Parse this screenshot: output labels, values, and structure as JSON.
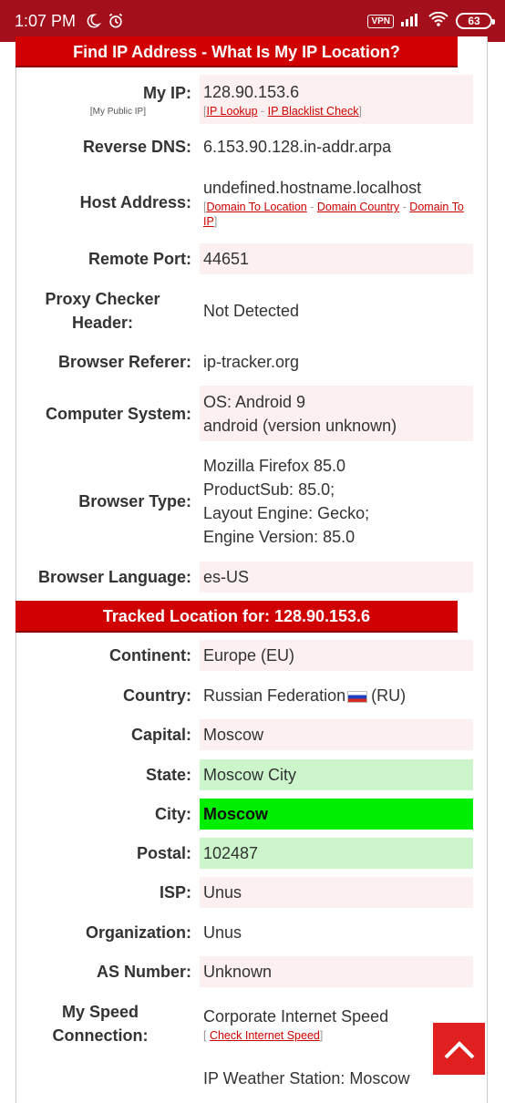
{
  "status_bar": {
    "time": "1:07 PM",
    "vpn": "VPN",
    "battery": "63"
  },
  "header1": {
    "title": "Find IP Address - What Is My IP Location?"
  },
  "rows1": [
    {
      "label": "My IP:",
      "sublabel": "[My Public IP]",
      "value": "128.90.153.6",
      "links": [
        "IP Lookup",
        "IP Blacklist Check"
      ],
      "bg": "pink"
    },
    {
      "label": "Reverse DNS:",
      "value": "6.153.90.128.in-addr.arpa"
    },
    {
      "label": "Host Address:",
      "value": "undefined.hostname.localhost",
      "links": [
        "Domain To Location",
        "Domain Country",
        "Domain To IP"
      ]
    },
    {
      "label": "Remote Port:",
      "value": "44651",
      "bg": "pink"
    },
    {
      "label": "Proxy Checker Header:",
      "value": "Not Detected"
    },
    {
      "label": "Browser Referer:",
      "value": "ip-tracker.org"
    },
    {
      "label": "Computer System:",
      "value_lines": [
        "OS: Android 9",
        "android (version unknown)"
      ],
      "bg": "pink"
    },
    {
      "label": "Browser Type:",
      "value_lines": [
        "Mozilla Firefox 85.0",
        "ProductSub: 85.0;",
        "Layout Engine: Gecko;",
        "Engine Version: 85.0"
      ]
    },
    {
      "label": "Browser Language:",
      "value": "es-US",
      "bg": "pink"
    }
  ],
  "header2": {
    "title": "Tracked Location for: 128.90.153.6"
  },
  "rows2": [
    {
      "label": "Continent:",
      "value": "Europe (EU)",
      "bg": "pink"
    },
    {
      "label": "Country:",
      "value": "Russian Federation",
      "value_suffix": "(RU)",
      "flag": "russia-flag-icon"
    },
    {
      "label": "Capital:",
      "value": "Moscow",
      "bg": "pink"
    },
    {
      "label": "State:",
      "value": "Moscow City",
      "bg": "lightgreen"
    },
    {
      "label": "City:",
      "value": "Moscow",
      "bg": "green"
    },
    {
      "label": "Postal:",
      "value": "102487",
      "bg": "lightgreen"
    },
    {
      "label": "ISP:",
      "value": "Unus",
      "bg": "pink"
    },
    {
      "label": "Organization:",
      "value": "Unus"
    },
    {
      "label": "AS Number:",
      "value": "Unknown",
      "bg": "pink"
    },
    {
      "label": "My Speed Connection:",
      "value": "Corporate Internet Speed",
      "links": [
        "Check Internet Speed"
      ]
    },
    {
      "label": "",
      "value": "IP Weather Station: Moscow"
    }
  ],
  "colors": {
    "brand_red": "#d00000",
    "status_bar": "#a40f1c",
    "pink_bg": "#fdf0f0",
    "green": "#00ee00",
    "light_green": "#ccf5cc"
  },
  "icons": {
    "scroll_top": "chevron-up-icon"
  }
}
